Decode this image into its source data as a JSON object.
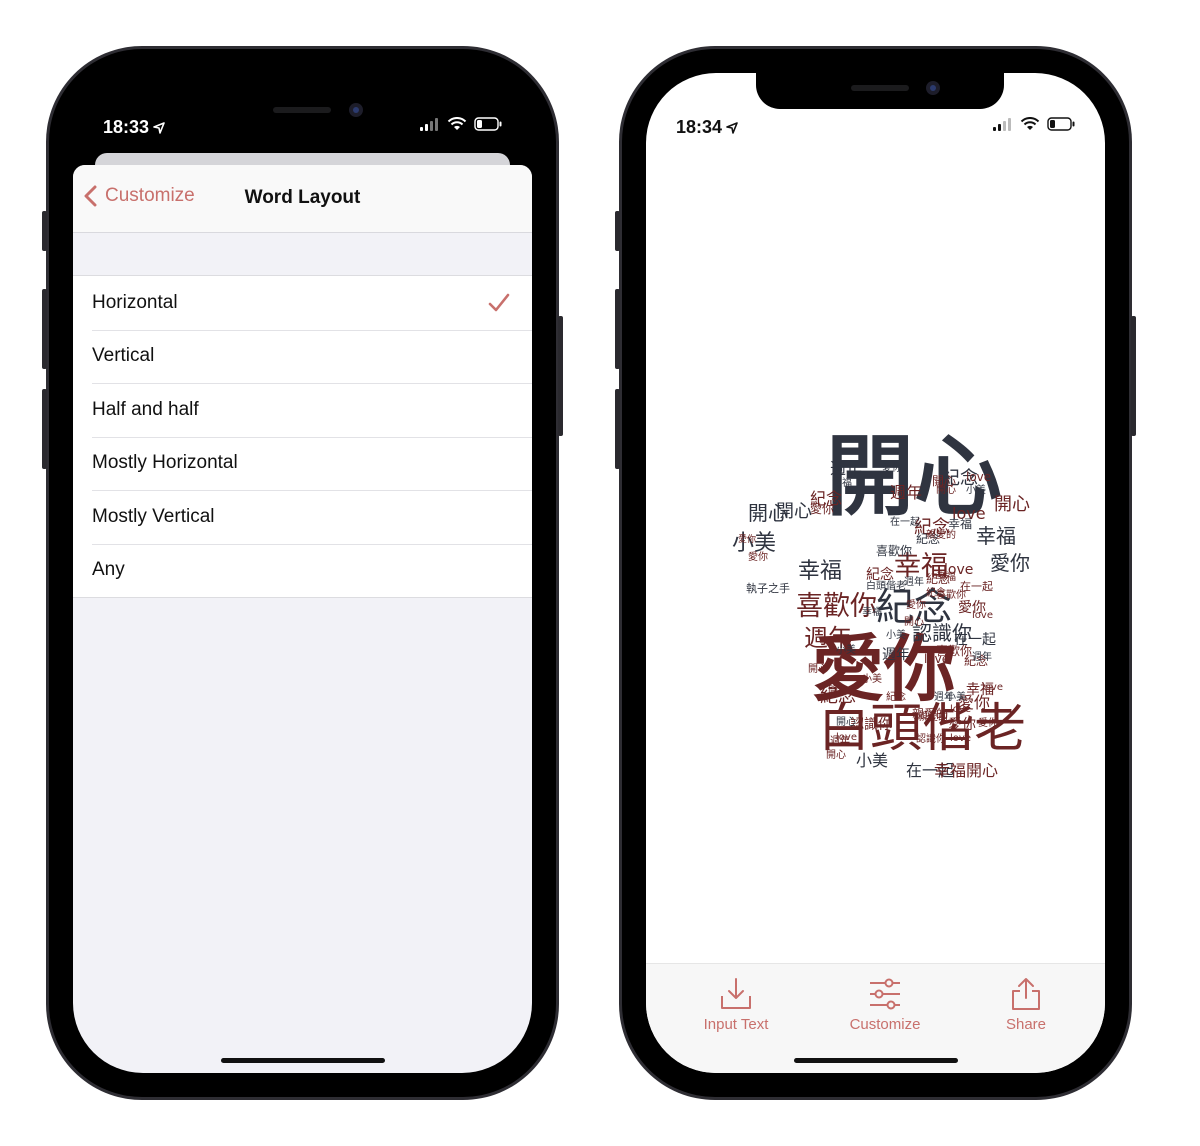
{
  "left_phone": {
    "status": {
      "time": "18:33"
    },
    "nav": {
      "back_label": "Customize",
      "title": "Word Layout"
    },
    "options": [
      {
        "label": "Horizontal",
        "selected": true
      },
      {
        "label": "Vertical",
        "selected": false
      },
      {
        "label": "Half and half",
        "selected": false
      },
      {
        "label": "Mostly Horizontal",
        "selected": false
      },
      {
        "label": "Mostly Vertical",
        "selected": false
      },
      {
        "label": "Any",
        "selected": false
      }
    ]
  },
  "right_phone": {
    "status": {
      "time": "18:34"
    },
    "word_cloud": {
      "shape": "t-shirt",
      "colors": {
        "dark": "#2f3440",
        "red": "#6b2424"
      },
      "words": [
        {
          "text": "開心",
          "c": "d"
        },
        {
          "text": "愛你",
          "c": "r"
        },
        {
          "text": "白頭偕老",
          "c": "r"
        },
        {
          "text": "紀念",
          "c": "d"
        },
        {
          "text": "喜歡你",
          "c": "r"
        },
        {
          "text": "幸福",
          "c": "r"
        },
        {
          "text": "認識你",
          "c": "d"
        },
        {
          "text": "週年",
          "c": "r"
        },
        {
          "text": "小美",
          "c": "d"
        },
        {
          "text": "開心",
          "c": "d"
        },
        {
          "text": "幸福",
          "c": "d"
        },
        {
          "text": "愛你",
          "c": "d"
        },
        {
          "text": "紀念",
          "c": "d"
        },
        {
          "text": "週年",
          "c": "d"
        },
        {
          "text": "開心",
          "c": "r"
        },
        {
          "text": "週年",
          "c": "r"
        },
        {
          "text": "紀念",
          "c": "r"
        },
        {
          "text": "love",
          "c": "r"
        },
        {
          "text": "love",
          "c": "r"
        },
        {
          "text": "幸福",
          "c": "d"
        },
        {
          "text": "小美",
          "c": "d"
        },
        {
          "text": "在一起",
          "c": "d"
        },
        {
          "text": "幸福",
          "c": "r"
        },
        {
          "text": "開心",
          "c": "r"
        },
        {
          "text": "認識你",
          "c": "r"
        },
        {
          "text": "紀念",
          "c": "r"
        },
        {
          "text": "愛你",
          "c": "r"
        },
        {
          "text": "幸福",
          "c": "d"
        },
        {
          "text": "紀念",
          "c": "r"
        },
        {
          "text": "開心",
          "c": "d"
        },
        {
          "text": "愛你",
          "c": "r"
        },
        {
          "text": "喜歡你",
          "c": "d"
        },
        {
          "text": "愛你",
          "c": "r"
        },
        {
          "text": "週年",
          "c": "d"
        },
        {
          "text": "親愛的",
          "c": "r"
        },
        {
          "text": "在一起",
          "c": "d"
        },
        {
          "text": "love",
          "c": "r"
        },
        {
          "text": "紀念",
          "c": "r"
        },
        {
          "text": "幸福",
          "c": "r"
        },
        {
          "text": "愛你",
          "c": "r"
        },
        {
          "text": "love",
          "c": "r"
        },
        {
          "text": "開心",
          "c": "r"
        },
        {
          "text": "小美",
          "c": "d"
        },
        {
          "text": "親愛的",
          "c": "r"
        },
        {
          "text": "愛你",
          "c": "r"
        },
        {
          "text": "週年",
          "c": "d"
        },
        {
          "text": "love",
          "c": "r"
        },
        {
          "text": "開心",
          "c": "r"
        },
        {
          "text": "紀念",
          "c": "r"
        },
        {
          "text": "白頭偕老",
          "c": "d"
        },
        {
          "text": "執子之手",
          "c": "d"
        },
        {
          "text": "在一起",
          "c": "r"
        },
        {
          "text": "喜歡你",
          "c": "r"
        },
        {
          "text": "小美",
          "c": "d"
        },
        {
          "text": "開心",
          "c": "r"
        },
        {
          "text": "幸福",
          "c": "r"
        },
        {
          "text": "love",
          "c": "r"
        },
        {
          "text": "紀念",
          "c": "r"
        },
        {
          "text": "愛你",
          "c": "r"
        },
        {
          "text": "週年",
          "c": "d"
        },
        {
          "text": "開心",
          "c": "r"
        },
        {
          "text": "小美",
          "c": "d"
        },
        {
          "text": "love",
          "c": "r"
        },
        {
          "text": "愛你",
          "c": "r"
        },
        {
          "text": "幸福",
          "c": "d"
        },
        {
          "text": "喜歡你",
          "c": "r"
        },
        {
          "text": "紀念",
          "c": "d"
        },
        {
          "text": "親愛的",
          "c": "r"
        },
        {
          "text": "在一起",
          "c": "d"
        },
        {
          "text": "開心",
          "c": "d"
        },
        {
          "text": "小美",
          "c": "r"
        },
        {
          "text": "認識你",
          "c": "r"
        },
        {
          "text": "love",
          "c": "r"
        },
        {
          "text": "愛你",
          "c": "r"
        },
        {
          "text": "紀念",
          "c": "r"
        },
        {
          "text": "週年",
          "c": "d"
        },
        {
          "text": "開心",
          "c": "r"
        },
        {
          "text": "幸福",
          "c": "d"
        },
        {
          "text": "love",
          "c": "r"
        },
        {
          "text": "愛你",
          "c": "d"
        },
        {
          "text": "小美",
          "c": "d"
        },
        {
          "text": "紀念",
          "c": "r"
        },
        {
          "text": "開心",
          "c": "r"
        },
        {
          "text": "週年",
          "c": "r"
        }
      ]
    },
    "toolbar": {
      "input_label": "Input Text",
      "customize_label": "Customize",
      "share_label": "Share"
    }
  },
  "colors": {
    "accent": "#c8706c"
  }
}
